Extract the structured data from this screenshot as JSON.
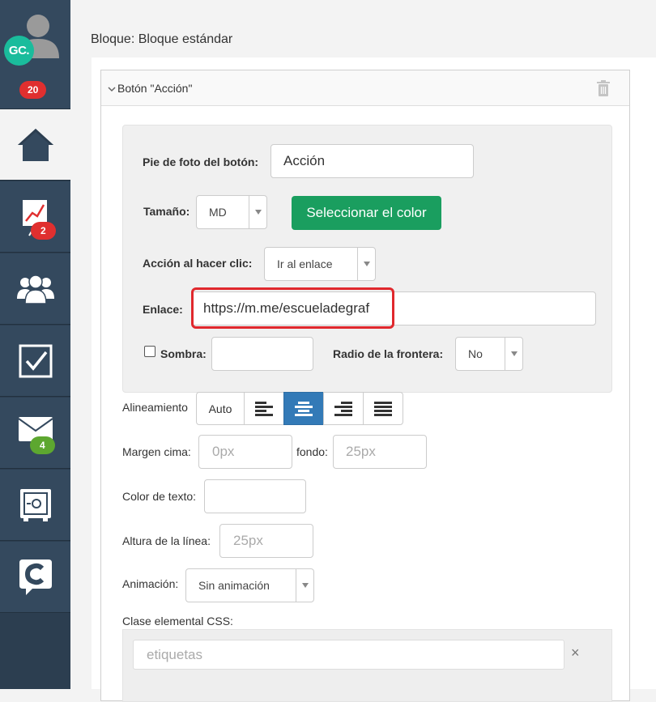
{
  "sidebar": {
    "avatar_initials": "GC.",
    "notification_count": "20",
    "items": [
      {
        "name": "home",
        "icon": "home-icon"
      },
      {
        "name": "reports",
        "icon": "chart-board-icon",
        "badge": "2"
      },
      {
        "name": "users",
        "icon": "users-icon"
      },
      {
        "name": "tasks",
        "icon": "checkbox-icon"
      },
      {
        "name": "mail",
        "icon": "envelope-icon",
        "badge": "4"
      },
      {
        "name": "vault",
        "icon": "safe-icon"
      },
      {
        "name": "chat",
        "icon": "chat-c-icon"
      }
    ]
  },
  "block_title": "Bloque: Bloque estándar",
  "panel": {
    "title": "Botón \"Acción\""
  },
  "form": {
    "caption_label": "Pie de foto del botón:",
    "caption_value": "Acción",
    "size_label": "Tamaño:",
    "size_value": "MD",
    "color_button": "Seleccionar el color",
    "action_label": "Acción al hacer clic:",
    "action_value": "Ir al enlace",
    "link_label": "Enlace:",
    "link_value": "https://m.me/escueladegraf",
    "shadow_label": "Sombra:",
    "radius_label": "Radio de la frontera:",
    "radius_value": "No",
    "align_label": "Alineamiento",
    "align_auto": "Auto",
    "margin_label": "Margen cima:",
    "margin_top_placeholder": "0px",
    "bottom_label": "fondo:",
    "margin_bottom_placeholder": "25px",
    "text_color_label": "Color de texto:",
    "line_height_label": "Altura de la línea:",
    "line_height_placeholder": "25px",
    "animation_label": "Animación:",
    "animation_value": "Sin animación",
    "css_class_label": "Clase elemental CSS:",
    "tags_placeholder": "etiquetas",
    "tags_clear": "×"
  },
  "colors": {
    "sidebar_bg": "#2c3e50",
    "accent_green": "#1a9e5f",
    "highlight_red": "#e0282d",
    "active_blue": "#337ab7"
  }
}
